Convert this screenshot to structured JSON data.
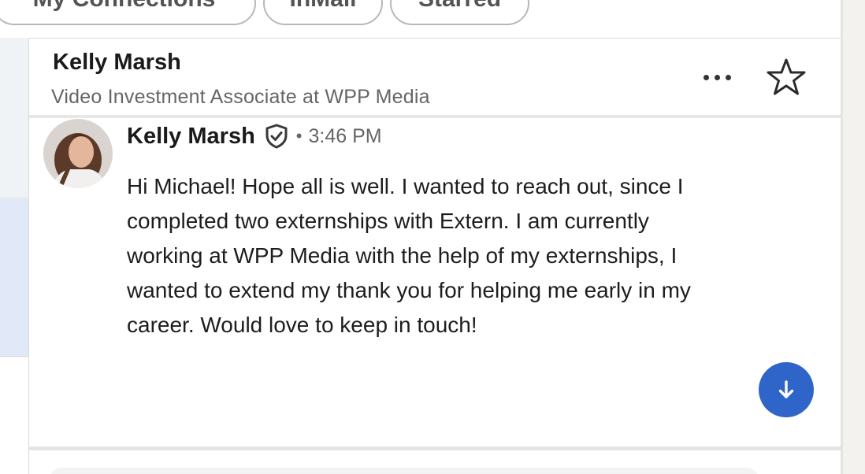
{
  "filters": {
    "items": [
      {
        "label": "My Connections"
      },
      {
        "label": "InMail"
      },
      {
        "label": "Starred"
      }
    ]
  },
  "conversation": {
    "header": {
      "name": "Kelly Marsh",
      "headline": "Video Investment Associate at WPP Media",
      "more_icon": "ellipsis-icon",
      "star_icon": "star-outline-icon"
    },
    "messages": [
      {
        "sender": "Kelly Marsh",
        "verified_icon": "verified-shield-icon",
        "separator": "•",
        "time": "3:46 PM",
        "body": "Hi Michael! Hope all is well. I wanted to reach out, since I completed two externships with Extern. I am currently working at WPP Media with the help of my externships, I wanted to extend my thank you for helping me early in my career. Would love to keep in touch!"
      }
    ],
    "scroll_icon": "arrow-down-icon"
  },
  "colors": {
    "accent": "#2f64c8",
    "selected_row": "#e1e9f8",
    "muted_text": "#666666"
  }
}
